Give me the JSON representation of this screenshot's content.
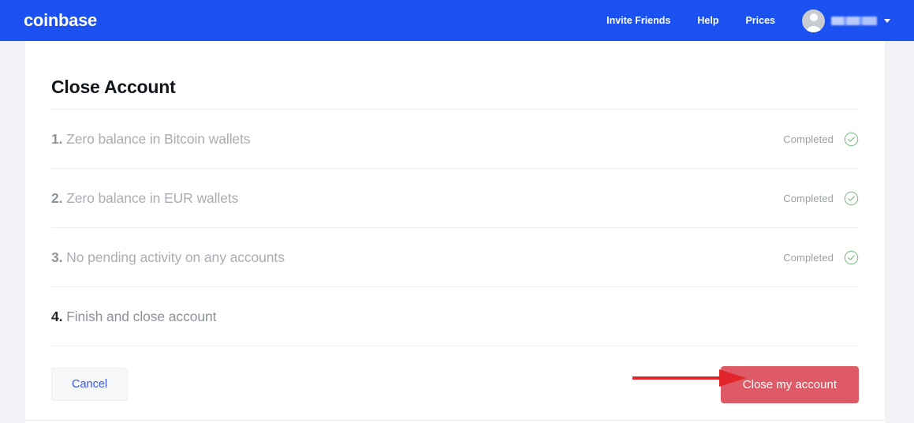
{
  "header": {
    "brand": "coinbase",
    "brand_color": "#1a51f0",
    "nav_links": [
      {
        "label": "Invite Friends",
        "name": "nav-invite-friends"
      },
      {
        "label": "Help",
        "name": "nav-help"
      },
      {
        "label": "Prices",
        "name": "nav-prices"
      }
    ],
    "account": {
      "avatar_icon": "user-avatar-icon",
      "username": "",
      "username_redacted": true,
      "caret_icon": "chevron-down-icon"
    }
  },
  "main": {
    "title": "Close Account",
    "steps": [
      {
        "number": "1.",
        "text": "Zero balance in Bitcoin wallets",
        "status": "Completed",
        "status_icon": "circle-check-icon",
        "complete": true
      },
      {
        "number": "2.",
        "text": "Zero balance in EUR wallets",
        "status": "Completed",
        "status_icon": "circle-check-icon",
        "complete": true
      },
      {
        "number": "3.",
        "text": "No pending activity on any accounts",
        "status": "Completed",
        "status_icon": "circle-check-icon",
        "complete": true
      },
      {
        "number": "4.",
        "text": "Finish and close account",
        "status": "",
        "status_icon": "",
        "complete": false
      }
    ],
    "actions": {
      "cancel_label": "Cancel",
      "close_account_label": "Close my account"
    }
  },
  "annotation": {
    "arrow_icon": "red-arrow-right-icon",
    "arrow_color": "#e2252b",
    "points_to": "Close my account"
  },
  "colors": {
    "header_blue": "#1a51f0",
    "danger_red": "#dd5a66",
    "link_blue": "#3a55f0",
    "check_green": "#84bd8c",
    "page_background": "#f0f2f5",
    "card_background": "#ffffff"
  }
}
